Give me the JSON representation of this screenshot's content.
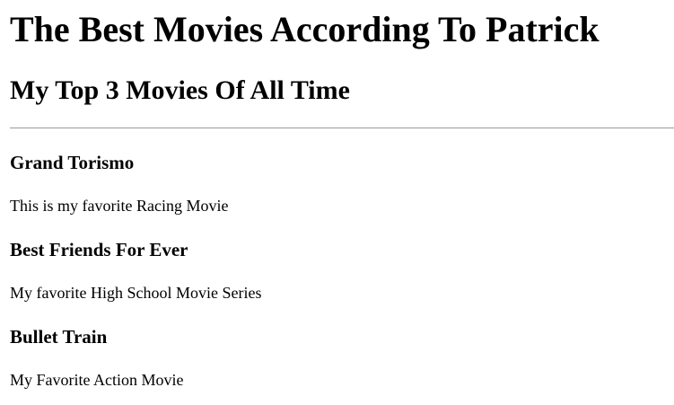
{
  "page": {
    "heading": "The Best Movies According To Patrick",
    "subheading": "My Top 3 Movies Of All Time"
  },
  "movies": [
    {
      "title": "Grand Torismo",
      "description": "This is my favorite Racing Movie"
    },
    {
      "title": "Best Friends For Ever",
      "description": "My favorite High School Movie Series"
    },
    {
      "title": "Bullet Train",
      "description": "My Favorite Action Movie"
    }
  ]
}
